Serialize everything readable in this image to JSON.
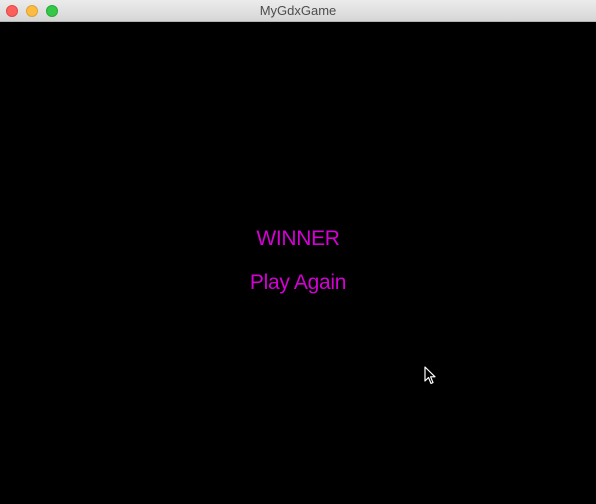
{
  "window": {
    "title": "MyGdxGame"
  },
  "game": {
    "result_text": "WINNER",
    "play_again_label": "Play Again"
  },
  "colors": {
    "background": "#000000",
    "text": "#d400d4"
  }
}
